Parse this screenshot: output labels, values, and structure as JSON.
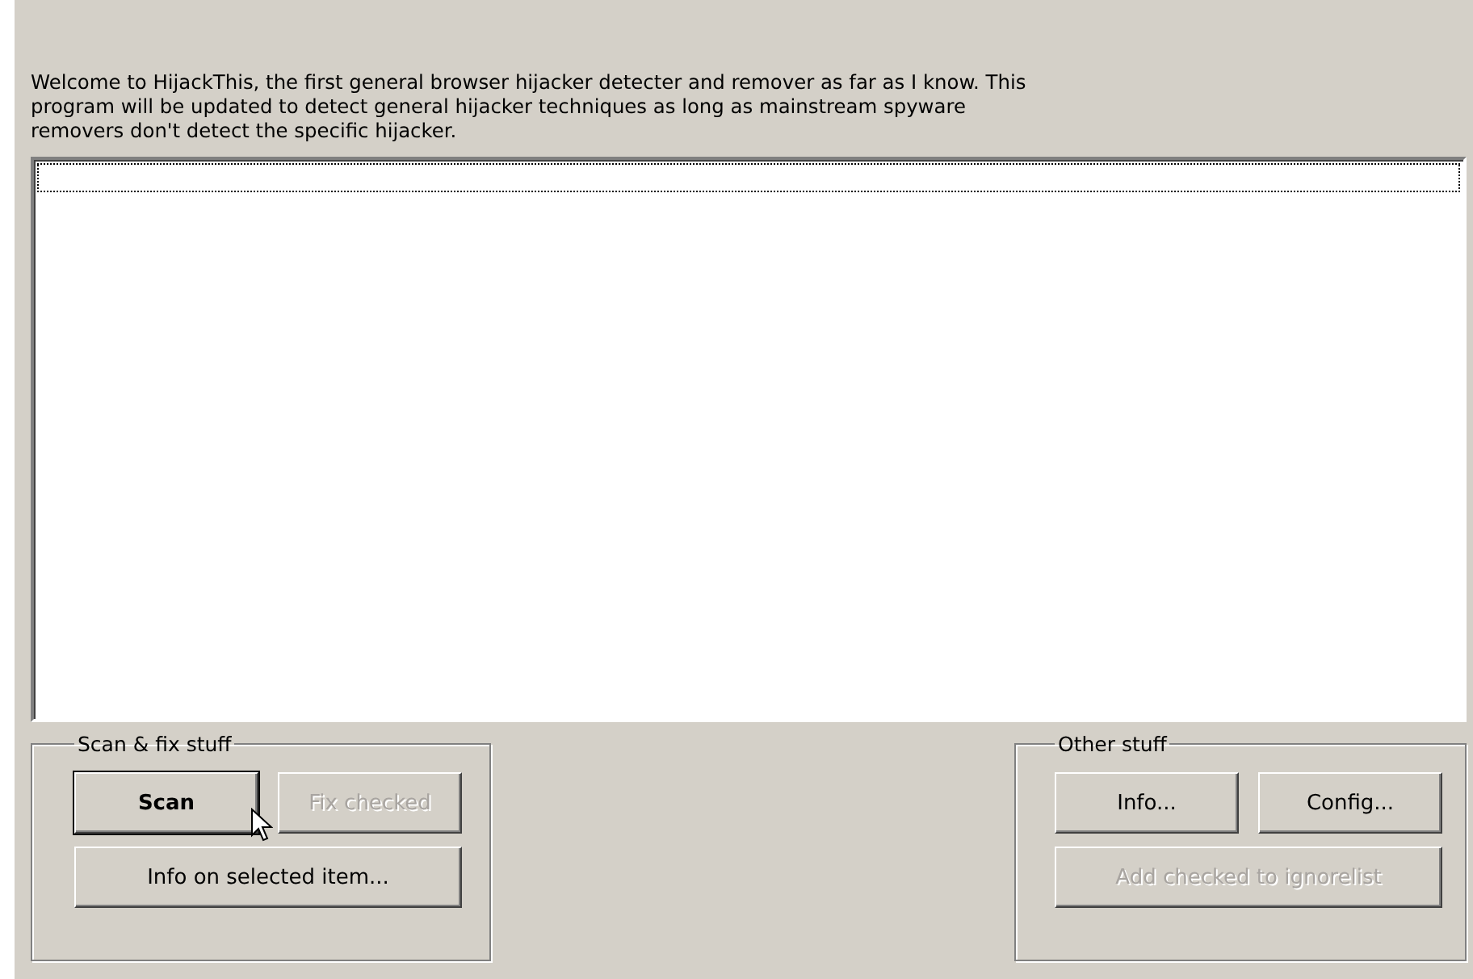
{
  "intro": "Welcome to HijackThis, the first general browser hijacker detecter and remover as far as I know. This program will be updated to detect general hijacker techniques as long as mainstream spyware removers don't detect the specific hijacker.",
  "results_list": {
    "focused": true
  },
  "groups": [
    {
      "title": "Scan & fix stuff",
      "rows": [
        [
          {
            "label": "Scan",
            "default": true,
            "disabled": false
          },
          {
            "label": "Fix checked",
            "default": false,
            "disabled": true
          }
        ],
        [
          {
            "label": "Info on selected item...",
            "default": false,
            "disabled": false
          }
        ]
      ]
    },
    {
      "title": "Other stuff",
      "rows": [
        [
          {
            "label": "Info...",
            "default": false,
            "disabled": false
          },
          {
            "label": "Config...",
            "default": false,
            "disabled": false
          }
        ],
        [
          {
            "label": "Add checked to ignorelist",
            "default": false,
            "disabled": true
          }
        ]
      ]
    }
  ]
}
